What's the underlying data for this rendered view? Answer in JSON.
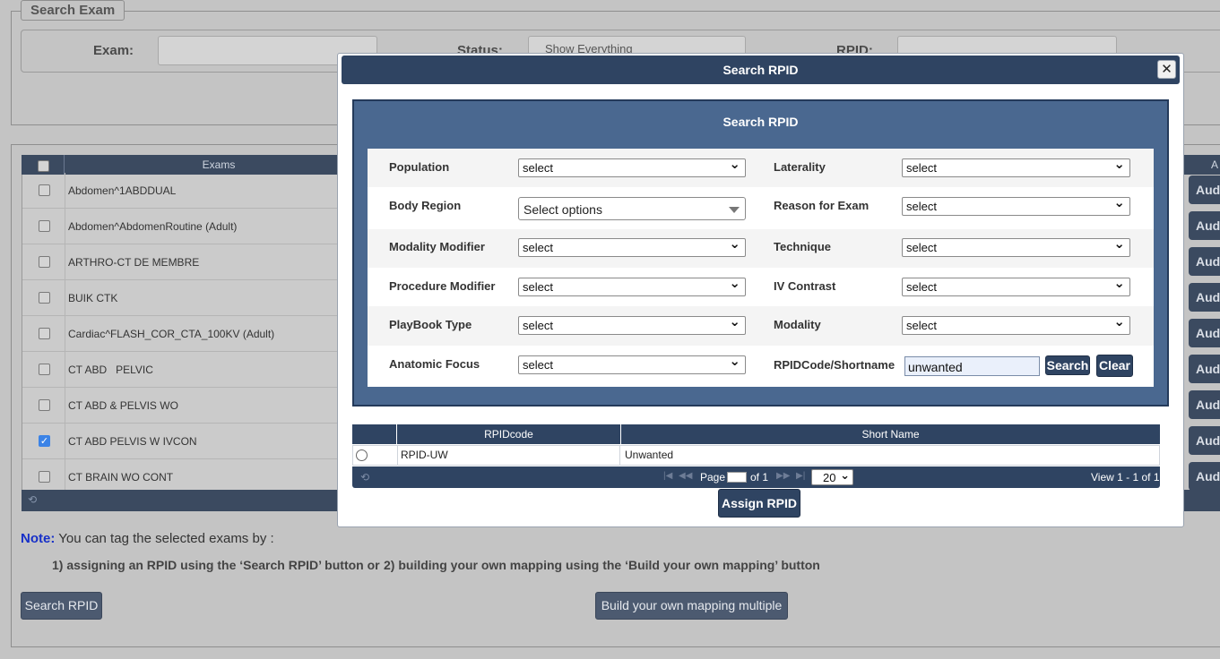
{
  "search_exam": {
    "legend": "Search Exam",
    "exam_label": "Exam:",
    "status_label": "Status:",
    "status_value": "Show Everything",
    "rpid_label": "RPID:"
  },
  "exams_grid": {
    "header": "Exams",
    "rows": [
      {
        "name": "Abdomen^1ABDDUAL",
        "checked": false
      },
      {
        "name": "Abdomen^AbdomenRoutine (Adult)",
        "checked": false
      },
      {
        "name": "ARTHRO-CT DE MEMBRE",
        "checked": false
      },
      {
        "name": "BUIK CTK",
        "checked": false
      },
      {
        "name": "Cardiac^FLASH_COR_CTA_100KV (Adult)",
        "checked": false
      },
      {
        "name": "CT ABD   PELVIC",
        "checked": false
      },
      {
        "name": "CT ABD & PELVIS WO",
        "checked": false
      },
      {
        "name": "CT ABD PELVIS W IVCON",
        "checked": true
      },
      {
        "name": "CT BRAIN WO CONT",
        "checked": false
      }
    ],
    "right_header": "A",
    "row_button": "Aud"
  },
  "note": {
    "label": "Note:",
    "text": " You can tag the selected exams by :",
    "hint1": "1) assigning an RPID using the ‘Search RPID’ button or",
    "hint2": "2) building your own mapping using the ‘Build your own mapping’ button",
    "search_btn": "Search RPID",
    "build_btn": "Build your own mapping multiple"
  },
  "modal": {
    "title": "Search RPID",
    "panel_title": "Search RPID",
    "fields": {
      "population": {
        "label": "Population",
        "value": "select"
      },
      "laterality": {
        "label": "Laterality",
        "value": "select"
      },
      "body_region": {
        "label": "Body Region",
        "value": "Select options"
      },
      "reason": {
        "label": "Reason for Exam",
        "value": "select"
      },
      "modality_modifier": {
        "label": "Modality Modifier",
        "value": "select"
      },
      "technique": {
        "label": "Technique",
        "value": "select"
      },
      "procedure_modifier": {
        "label": "Procedure Modifier",
        "value": "select"
      },
      "iv_contrast": {
        "label": "IV Contrast",
        "value": "select"
      },
      "playbook": {
        "label": "PlayBook Type",
        "value": "select"
      },
      "modality": {
        "label": "Modality",
        "value": "select"
      },
      "anatomic": {
        "label": "Anatomic Focus",
        "value": "select"
      },
      "rpidcode": {
        "label": "RPIDCode/Shortname",
        "value": "unwanted"
      }
    },
    "search_btn": "Search",
    "clear_btn": "Clear",
    "results": {
      "col_code": "RPIDcode",
      "col_name": "Short Name",
      "rows": [
        {
          "code": "RPID-UW",
          "name": "Unwanted"
        }
      ]
    },
    "pager": {
      "page_label": "Page",
      "of_label": "of 1",
      "page_size": "20",
      "view": "View 1 - 1 of 1"
    },
    "assign_btn": "Assign RPID"
  }
}
